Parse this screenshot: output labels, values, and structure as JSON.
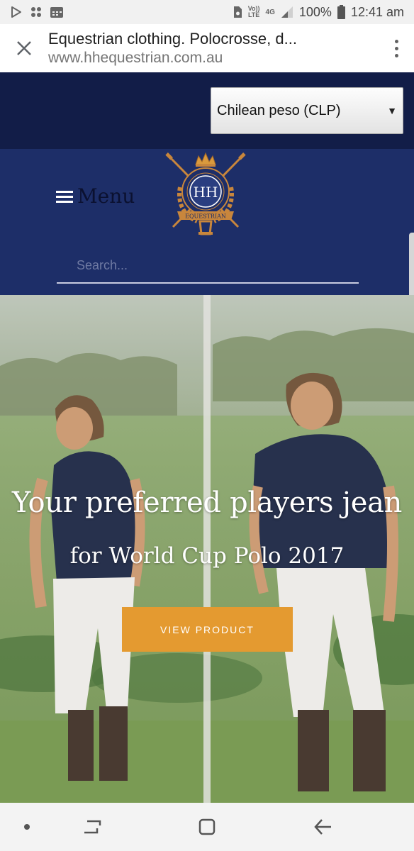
{
  "status_bar": {
    "volte_top": "Vo))",
    "volte_bottom": "LTE",
    "network": "4G",
    "battery": "100%",
    "time": "12:41 am"
  },
  "browser": {
    "title": "Equestrian clothing. Polocrosse, d...",
    "url": "www.hhequestrian.com.au"
  },
  "currency": {
    "selected": "Chilean peso (CLP)"
  },
  "header": {
    "menu_label": "Menu",
    "search_placeholder": "Search..."
  },
  "hero": {
    "headline": "Your preferred players jean",
    "subheadline": "for World Cup Polo 2017",
    "button_label": "VIEW PRODUCT"
  },
  "colors": {
    "currency_strip": "#121d48",
    "header_bg": "#1d2e68",
    "button": "#e49a30",
    "logo_gold": "#c8863c"
  },
  "icons": [
    "play-store-icon",
    "apps-icon",
    "calendar-icon",
    "sim-icon",
    "signal-icon",
    "battery-icon",
    "close-icon",
    "more-vert-icon",
    "hamburger-icon",
    "dropdown-caret-icon",
    "recents-icon",
    "home-icon",
    "back-icon"
  ]
}
